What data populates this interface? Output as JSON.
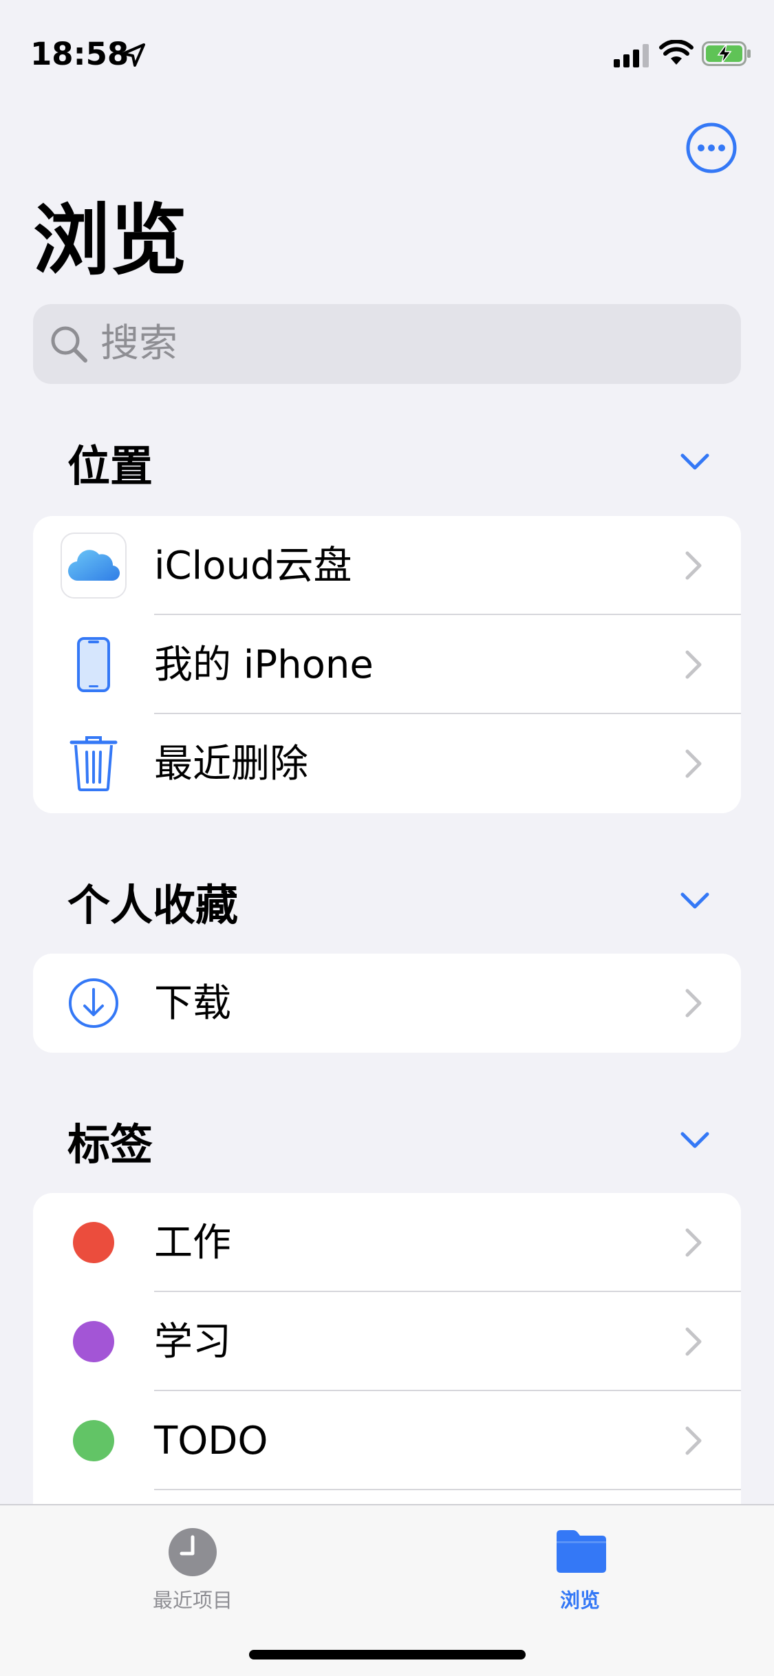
{
  "status_bar": {
    "time": "18:58"
  },
  "page": {
    "title": "浏览"
  },
  "search": {
    "placeholder": "搜索"
  },
  "sections": {
    "locations": {
      "title": "位置",
      "items": [
        {
          "label": "iCloud云盘",
          "icon": "icloud-icon"
        },
        {
          "label": "我的 iPhone",
          "icon": "iphone-icon"
        },
        {
          "label": "最近删除",
          "icon": "trash-icon"
        }
      ]
    },
    "favorites": {
      "title": "个人收藏",
      "items": [
        {
          "label": "下载",
          "icon": "download-icon"
        }
      ]
    },
    "tags": {
      "title": "标签",
      "items": [
        {
          "label": "工作",
          "color": "#eb4d3d"
        },
        {
          "label": "学习",
          "color": "#a355d6"
        },
        {
          "label": "TODO",
          "color": "#62c466"
        }
      ]
    }
  },
  "tab_bar": {
    "tabs": [
      {
        "label": "最近项目",
        "icon": "clock-icon",
        "selected": false
      },
      {
        "label": "浏览",
        "icon": "folder-icon",
        "selected": true
      }
    ]
  },
  "colors": {
    "accent": "#3478f6",
    "background": "#f2f2f7"
  }
}
